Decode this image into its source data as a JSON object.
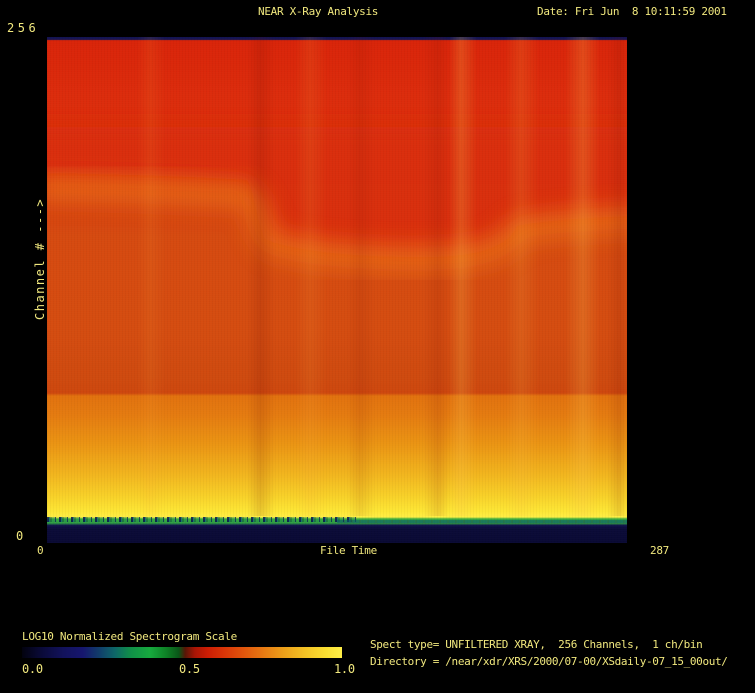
{
  "header": {
    "title": "NEAR X-Ray Analysis",
    "date_label": "Date: Fri Jun  8 10:11:59 2001"
  },
  "plot": {
    "y_axis": {
      "label": "Channel # --->",
      "max_tick": "256",
      "min_tick": "0"
    },
    "x_axis": {
      "label": "File Time",
      "min_tick": "0",
      "max_tick": "287"
    }
  },
  "colorbar": {
    "title": "LOG10 Normalized Spectrogram Scale",
    "ticks": [
      "0.0",
      "0.5",
      "1.0"
    ]
  },
  "info": {
    "spect_line": "Spect type= UNFILTERED XRAY,  256 Channels,  1 ch/bin",
    "directory_line": "Directory = /near/xdr/XRS/2000/07-00/XSdaily-07_15_00out/"
  },
  "colors": {
    "text": "#f1e87e",
    "background": "#000000",
    "spectro_red": "#dc2c0c",
    "spectro_orange": "#d64a10",
    "spectro_yellow": "#ffee44",
    "spectro_green_stripe": "#2f9e44",
    "spectro_navy": "#0b0b38"
  },
  "chart_data": {
    "type": "heatmap",
    "title": "NEAR X-Ray Analysis",
    "xlabel": "File Time",
    "ylabel": "Channel # --->",
    "x_range": [
      0,
      287
    ],
    "y_range": [
      0,
      256
    ],
    "colorbar": {
      "label": "LOG10 Normalized Spectrogram Scale",
      "range": [
        0.0,
        1.0
      ],
      "ticks": [
        0.0,
        0.5,
        1.0
      ],
      "palette": "dark-navy -> blue -> teal -> green -> dark-red -> red -> orange -> yellow"
    },
    "grid": false,
    "legend_position": "bottom-left",
    "row_profile": [
      {
        "channels": "253-256",
        "value": 0.07,
        "appearance": "thin dark navy strip across top edge"
      },
      {
        "channels": "78-253",
        "value": 0.62,
        "appearance": "red at high channels grading to red-orange lower; brightest red near channel 230-256"
      },
      {
        "channels": "145-185",
        "value": 0.7,
        "appearance": "wavy brighter orange band; sits near channel 180 at left, dips to ~150 mid-time, rises to ~162 at right"
      },
      {
        "channels": "13-78",
        "value": 0.8,
        "appearance": "orange grading smoothly to bright yellow toward low channels; sharp step to brighter orange at channel ~75"
      },
      {
        "channels": "10-13",
        "value": 0.45,
        "appearance": "green stripe with noisy navy/teal speckle on left half of time axis"
      },
      {
        "channels": "0-10",
        "value": 0.05,
        "appearance": "uniform dark navy band at bottom"
      }
    ],
    "column_features": [
      {
        "x_approx": 51,
        "type": "faint bright vertical streak"
      },
      {
        "x_approx": 105,
        "type": "dark vertical streak"
      },
      {
        "x_approx": 130,
        "type": "faint bright vertical streak"
      },
      {
        "x_approx": 155,
        "type": "faint dark vertical streak"
      },
      {
        "x_approx": 194,
        "type": "dark vertical streak"
      },
      {
        "x_approx": 204,
        "type": "strong bright vertical streak"
      },
      {
        "x_approx": 235,
        "type": "medium bright vertical streak"
      },
      {
        "x_approx": 265,
        "type": "strong bright vertical streak"
      },
      {
        "x_approx": 282,
        "type": "dark vertical streak"
      }
    ]
  }
}
